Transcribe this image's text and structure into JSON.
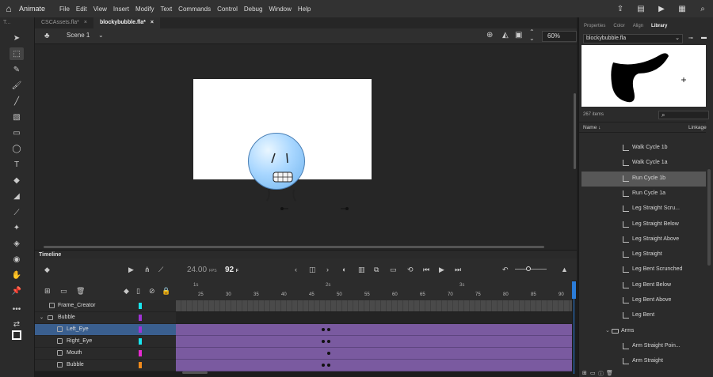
{
  "app": {
    "name": "Animate"
  },
  "menu": [
    "File",
    "Edit",
    "View",
    "Insert",
    "Modify",
    "Text",
    "Commands",
    "Control",
    "Debug",
    "Window",
    "Help"
  ],
  "toolbar": {
    "header": "T..."
  },
  "doc_tabs": [
    {
      "label": "CSCAssets.fla*",
      "close": "×",
      "active": false
    },
    {
      "label": "blockybubble.fla*",
      "close": "×",
      "active": true
    }
  ],
  "editbar": {
    "scene": "Scene 1",
    "zoom": "60%"
  },
  "timeline": {
    "title": "Timeline",
    "fps": "24.00",
    "fps_unit": "FPS",
    "current_frame": "92",
    "frame_unit": "F",
    "ruler_seconds": [
      "1s",
      "2s",
      "3s"
    ],
    "ruler_numbers": [
      "25",
      "30",
      "35",
      "40",
      "45",
      "50",
      "55",
      "60",
      "65",
      "70",
      "75",
      "80",
      "85",
      "90"
    ],
    "layers": [
      {
        "name": "Frame_Creator",
        "color": "#19e5ee",
        "type": "layer",
        "selected": false
      },
      {
        "name": "Bubble",
        "color": "#a033d6",
        "type": "folder",
        "selected": false
      },
      {
        "name": "Left_Eye",
        "color": "#a033d6",
        "type": "layer",
        "selected": true
      },
      {
        "name": "Right_Eye",
        "color": "#19e5ee",
        "type": "layer",
        "selected": false
      },
      {
        "name": "Mouth",
        "color": "#e52bd0",
        "type": "layer",
        "selected": false
      },
      {
        "name": "Bubble",
        "color": "#f08a1c",
        "type": "layer",
        "selected": false
      }
    ]
  },
  "panel": {
    "tabs": [
      "Properties",
      "Color",
      "Align",
      "Library"
    ],
    "active_tab": "Library",
    "library_doc": "blockybubble.fla",
    "item_count": "267 items",
    "col_name": "Name",
    "col_linkage": "Linkage",
    "items": [
      {
        "label": "Walk Cycle 1b",
        "selected": false,
        "folder": false
      },
      {
        "label": "Walk Cycle 1a",
        "selected": false,
        "folder": false
      },
      {
        "label": "Run Cycle 1b",
        "selected": true,
        "folder": false
      },
      {
        "label": "Run Cycle 1a",
        "selected": false,
        "folder": false
      },
      {
        "label": "Leg Straight Scru...",
        "selected": false,
        "folder": false
      },
      {
        "label": "Leg Straight Below",
        "selected": false,
        "folder": false
      },
      {
        "label": "Leg Straight Above",
        "selected": false,
        "folder": false
      },
      {
        "label": "Leg Straight",
        "selected": false,
        "folder": false
      },
      {
        "label": "Leg Bent Scrunched",
        "selected": false,
        "folder": false
      },
      {
        "label": "Leg Bent Below",
        "selected": false,
        "folder": false
      },
      {
        "label": "Leg Bent Above",
        "selected": false,
        "folder": false
      },
      {
        "label": "Leg Bent",
        "selected": false,
        "folder": false
      },
      {
        "label": "Arms",
        "selected": false,
        "folder": true
      },
      {
        "label": "Arm Straight Poin...",
        "selected": false,
        "folder": false
      },
      {
        "label": "Arm Straight",
        "selected": false,
        "folder": false
      }
    ]
  },
  "colors": {
    "accent": "#2b7cd8",
    "frames_purple": "#7a5aa0",
    "selection": "#3a5f8f"
  }
}
